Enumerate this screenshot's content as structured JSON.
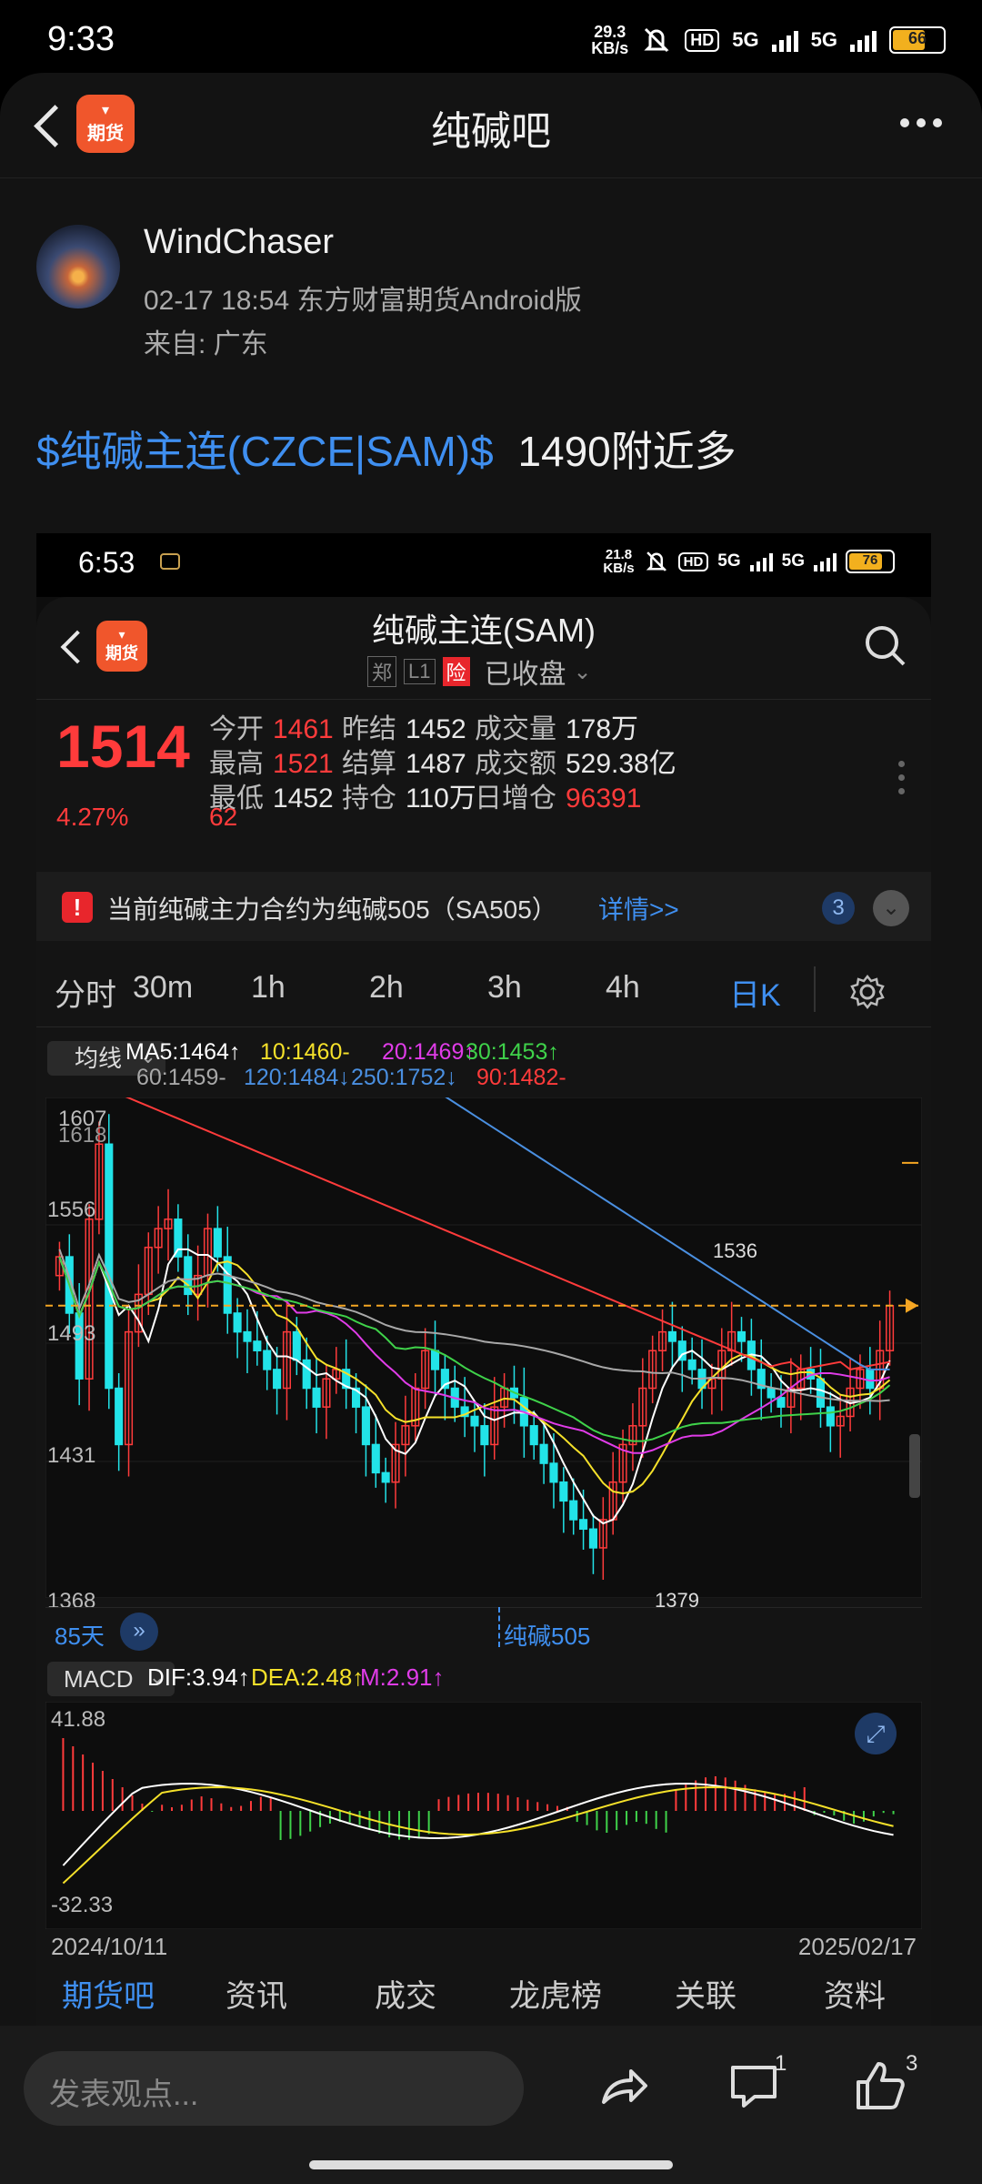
{
  "status_bar": {
    "time": "9:33",
    "speed_top": "29.3",
    "speed_bottom": "KB/s",
    "hd": "HD",
    "net1": "5G",
    "net2": "5G",
    "battery": "66"
  },
  "header": {
    "title": "纯碱吧",
    "logo_text": "期货"
  },
  "post": {
    "author": "WindChaser",
    "meta": "02-17 18:54 东方财富期货Android版",
    "location": "来自: 广东",
    "stock_link": "$纯碱主连(CZCE|SAM)$",
    "text": "1490附近多"
  },
  "screenshot": {
    "status": {
      "time": "6:53",
      "speed_top": "21.8",
      "speed_bottom": "KB/s",
      "hd": "HD",
      "net1": "5G",
      "net2": "5G",
      "battery": "76"
    },
    "title": "纯碱主连(SAM)",
    "tags": [
      "郑",
      "L1",
      "险"
    ],
    "state": "已收盘",
    "price": "1514",
    "change_pct": "4.27%",
    "change": "62",
    "stats": [
      {
        "label": "今开",
        "value": "1461",
        "color": "red"
      },
      {
        "label": "昨结",
        "value": "1452",
        "color": "normal"
      },
      {
        "label": "成交量",
        "value": "178万",
        "color": "normal"
      },
      {
        "label": "最高",
        "value": "1521",
        "color": "red"
      },
      {
        "label": "结算",
        "value": "1487",
        "color": "normal"
      },
      {
        "label": "成交额",
        "value": "529.38亿",
        "color": "normal"
      },
      {
        "label": "最低",
        "value": "1452",
        "color": "normal"
      },
      {
        "label": "持仓",
        "value": "110万",
        "color": "normal"
      },
      {
        "label": "日增仓",
        "value": "96391",
        "color": "red"
      }
    ],
    "notice": "当前纯碱主力合约为纯碱505（SA505）",
    "notice_link": "详情>>",
    "notice_count": "3",
    "tabs": [
      "分时",
      "30m",
      "1h",
      "2h",
      "3h",
      "4h",
      "日K"
    ],
    "active_tab": "日K",
    "ma_select": "均线",
    "ma_values": [
      {
        "label": "MA5:1464↑",
        "color": "#ffffff"
      },
      {
        "label": "10:1460-",
        "color": "#f5e12a"
      },
      {
        "label": "20:1469↑",
        "color": "#e03ce8"
      },
      {
        "label": "30:1453↑",
        "color": "#3fd24a"
      },
      {
        "label": "60:1459-",
        "color": "#a8a8a8"
      },
      {
        "label": "120:1484↓",
        "color": "#4a8fe0"
      },
      {
        "label": "250:1752↓",
        "color": "#4a8fe0"
      },
      {
        "label": "90:1482-",
        "color": "#ff3b3b"
      }
    ],
    "y_labels": [
      "1607",
      "1618",
      "1556",
      "1493",
      "1431",
      "1368"
    ],
    "high_label": "1536",
    "low_label": "1379",
    "period_label": "85天",
    "contract_label": "纯碱505",
    "macd_select": "MACD",
    "macd_values": [
      {
        "label": "DIF:3.94↑",
        "color": "#ffffff"
      },
      {
        "label": "DEA:2.48↑",
        "color": "#f5e12a"
      },
      {
        "label": "M:2.91↑",
        "color": "#e03ce8"
      }
    ],
    "macd_top": "41.88",
    "macd_bottom": "-32.33",
    "date_start": "2024/10/11",
    "date_end": "2025/02/17",
    "bottom_tabs": [
      "期货吧",
      "资讯",
      "成交",
      "龙虎榜",
      "关联",
      "资料"
    ],
    "active_bottom_tab": "期货吧",
    "colors": {
      "up": "#ff3b3b",
      "down": "#22e3e8",
      "ma5": "#ffffff",
      "ma10": "#f5e12a",
      "ma20": "#e03ce8",
      "ma30": "#3fd24a",
      "ma60": "#a8a8a8",
      "ma120": "#4a8fe0",
      "ma90": "#ff3b3b"
    }
  },
  "bottom_bar": {
    "placeholder": "发表观点...",
    "comment_count": "1",
    "like_count": "3"
  }
}
